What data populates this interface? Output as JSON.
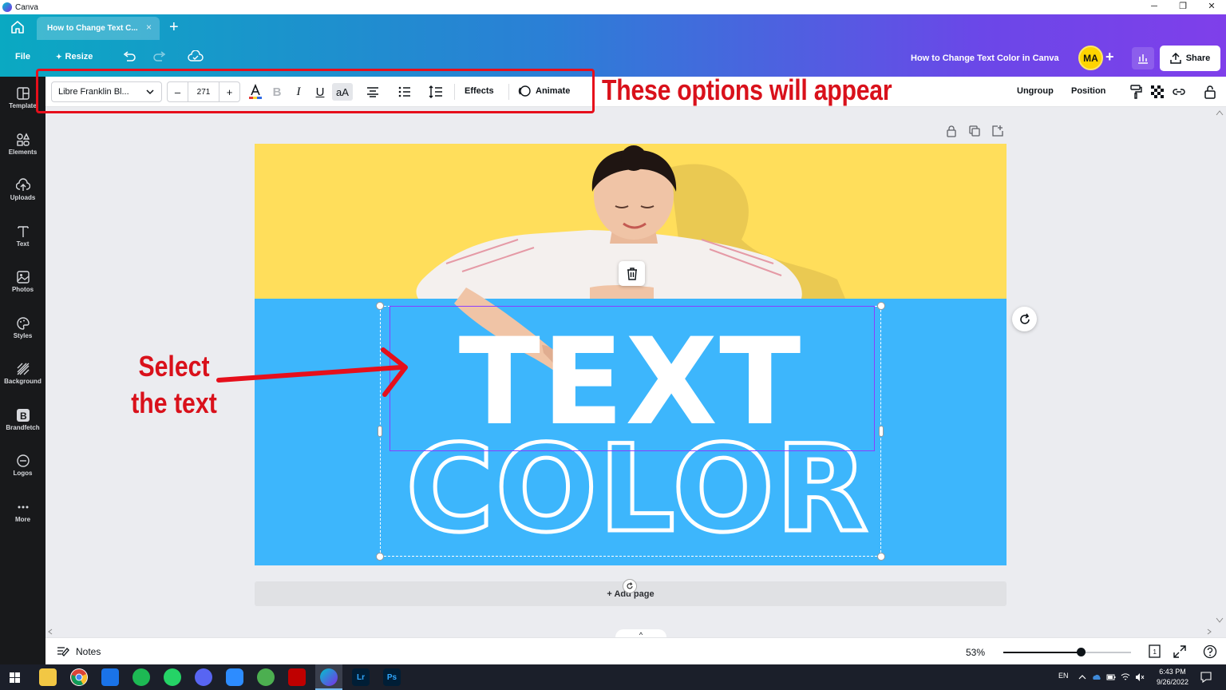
{
  "window": {
    "app_name": "Canva",
    "minimize": "─",
    "restore": "❐",
    "close": "✕"
  },
  "tabs": {
    "active_title": "How to Change Text C...",
    "close": "×",
    "new_tab": "+"
  },
  "menubar": {
    "file": "File",
    "resize": "Resize",
    "design_title": "How to Change Text Color in Canva",
    "avatar_initials": "MA",
    "add": "+",
    "share": "Share"
  },
  "sidebar": {
    "items": [
      {
        "label": "Template",
        "icon": "template-icon"
      },
      {
        "label": "Elements",
        "icon": "elements-icon"
      },
      {
        "label": "Uploads",
        "icon": "uploads-icon"
      },
      {
        "label": "Text",
        "icon": "text-icon"
      },
      {
        "label": "Photos",
        "icon": "photos-icon"
      },
      {
        "label": "Styles",
        "icon": "styles-icon"
      },
      {
        "label": "Background",
        "icon": "background-icon"
      },
      {
        "label": "Brandfetch",
        "icon": "brandfetch-icon"
      },
      {
        "label": "Logos",
        "icon": "logos-icon"
      },
      {
        "label": "More",
        "icon": "more-icon"
      }
    ]
  },
  "toolbar": {
    "font": "Libre Franklin Bl...",
    "size_minus": "–",
    "size": "271",
    "size_plus": "+",
    "bold": "B",
    "italic": "I",
    "underline": "U",
    "case": "aA",
    "effects": "Effects",
    "animate": "Animate",
    "ungroup": "Ungroup",
    "position": "Position",
    "text_color_bar": "#2f6be5"
  },
  "annotations": {
    "top": "These options will appear",
    "left_line1": "Select",
    "left_line2": "the text",
    "color": "#e60f1b"
  },
  "design": {
    "word1": "TEXT",
    "word2": "COLOR",
    "top_color": "#ffde5b",
    "bottom_color": "#3db6fc"
  },
  "canvas": {
    "add_page": "+ Add page",
    "drawer": "^"
  },
  "footer": {
    "notes": "Notes",
    "zoom": "53%",
    "zoom_level": 0.53,
    "page_count": "1"
  },
  "taskbar": {
    "apps": [
      "File Explorer",
      "Chrome",
      "Outlook",
      "Spotify",
      "WhatsApp",
      "Discord",
      "Zoom",
      "Browser",
      "FileZilla",
      "Canva",
      "Lr",
      "Ps"
    ],
    "lr": "Lr",
    "ps": "Ps",
    "lang": "EN",
    "time": "6:43 PM",
    "date": "9/26/2022"
  }
}
